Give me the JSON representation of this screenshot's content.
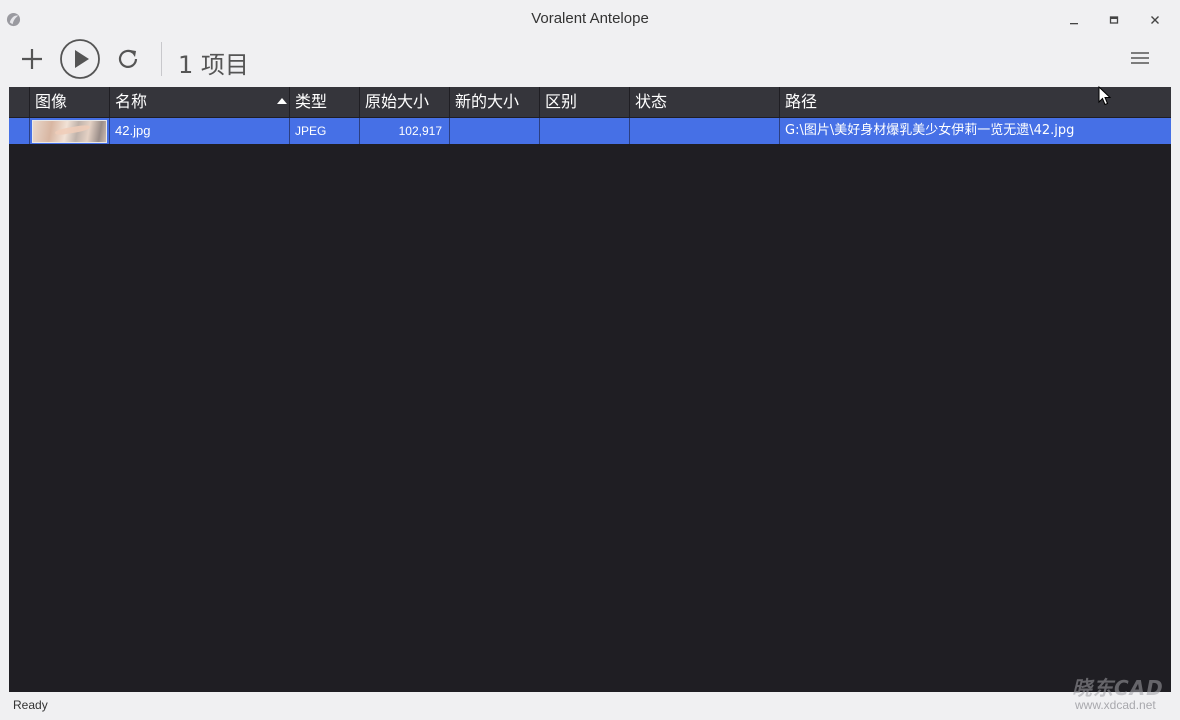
{
  "window": {
    "title": "Voralent Antelope",
    "minimize_label": "_",
    "maximize_label": "▭",
    "close_label": "✕"
  },
  "toolbar": {
    "add_icon": "plus-icon",
    "run_icon": "play-circle-icon",
    "refresh_icon": "refresh-icon",
    "count_label": "1 项目",
    "menu_icon": "hamburger-menu-icon"
  },
  "table": {
    "columns": [
      "图像",
      "名称",
      "类型",
      "原始大小",
      "新的大小",
      "区别",
      "状态",
      "路径"
    ],
    "sort_column": "名称",
    "sort_direction": "ascending",
    "rows": [
      {
        "image": "thumbnail",
        "name": "42.jpg",
        "type": "JPEG",
        "original_size": "102,917",
        "new_size": "",
        "difference": "",
        "status": "",
        "path": "G:\\图片\\美好身材爆乳美少女伊莉一览无遗\\42.jpg",
        "selected": true
      }
    ]
  },
  "status": {
    "text": "Ready"
  },
  "watermark": {
    "logo": "晓东CAD",
    "url": "www.xdcad.net"
  },
  "colors": {
    "table_bg": "#1f1e23",
    "header_bg": "#35353b",
    "selected_row": "#4670e6",
    "chrome_bg": "#f0f0f2"
  }
}
